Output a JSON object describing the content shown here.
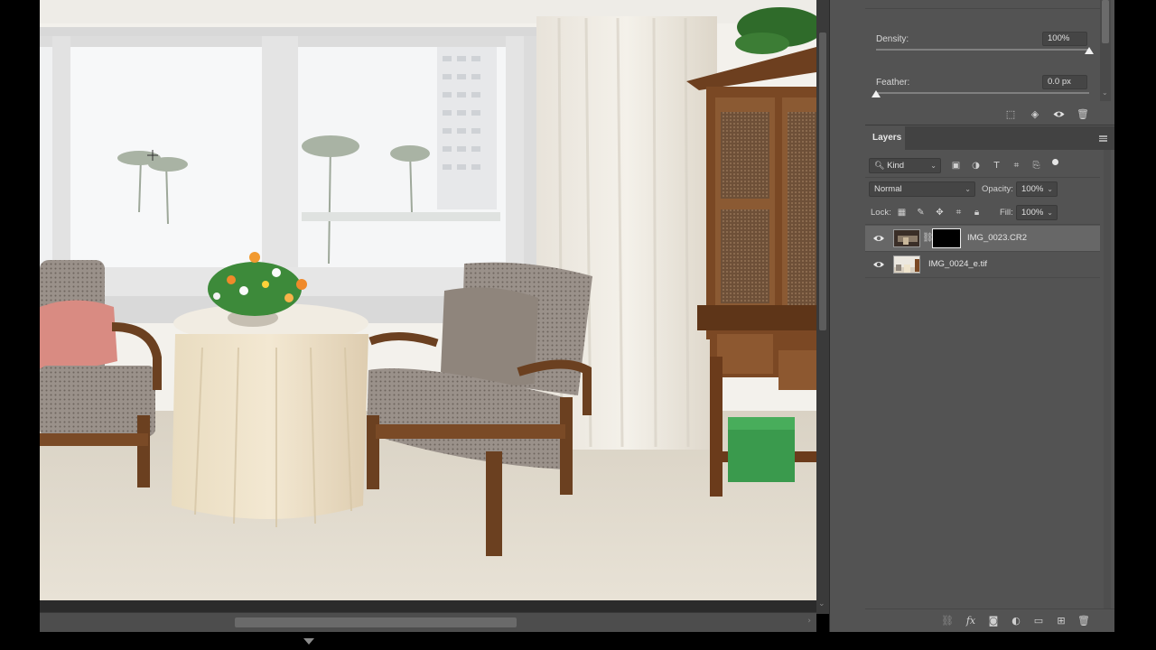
{
  "properties": {
    "density_label": "Density:",
    "density_value": "100%",
    "density_level": 1.0,
    "feather_label": "Feather:",
    "feather_value": "0.0 px",
    "feather_level": 0.0
  },
  "layers_panel": {
    "tab_label": "Layers",
    "filter_kind": "Kind",
    "blend_mode": "Normal",
    "opacity_label": "Opacity:",
    "opacity_value": "100%",
    "lock_label": "Lock:",
    "fill_label": "Fill:",
    "fill_value": "100%",
    "layers": [
      {
        "name": "IMG_0023.CR2",
        "visible": true,
        "selected": true,
        "has_mask": true
      },
      {
        "name": "IMG_0024_e.tif",
        "visible": true,
        "selected": false,
        "has_mask": false
      }
    ]
  },
  "icons": {
    "props_row": [
      "selection-icon",
      "invert-mask-icon",
      "eye-icon",
      "trash-icon"
    ],
    "footer": [
      "link-layers-icon",
      "fx-icon",
      "add-mask-icon",
      "adjustment-layer-icon",
      "group-folder-icon",
      "new-layer-icon",
      "delete-layer-icon"
    ]
  },
  "colors": {
    "panel_bg": "#535353",
    "selected_row": "#676767",
    "header_bg": "#424242"
  }
}
